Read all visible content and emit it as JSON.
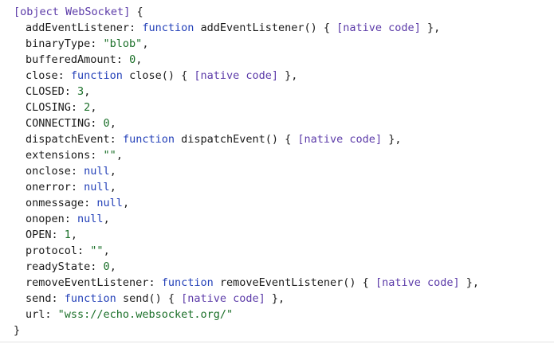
{
  "output": {
    "open": {
      "bracket_open": "[",
      "label": "object WebSocket",
      "bracket_close": "]",
      "brace": " {"
    },
    "props": [
      {
        "key": "addEventListener",
        "kind": "fn",
        "prefix": "function ",
        "fname": "addEventListener",
        "parens": "() { ",
        "native": "[native code]",
        "tail": " },"
      },
      {
        "key": "binaryType",
        "kind": "str",
        "value": "\"blob\"",
        "tail": ","
      },
      {
        "key": "bufferedAmount",
        "kind": "num",
        "value": "0",
        "tail": ","
      },
      {
        "key": "close",
        "kind": "fn",
        "prefix": "function ",
        "fname": "close",
        "parens": "() { ",
        "native": "[native code]",
        "tail": " },"
      },
      {
        "key": "CLOSED",
        "kind": "num",
        "value": "3",
        "tail": ","
      },
      {
        "key": "CLOSING",
        "kind": "num",
        "value": "2",
        "tail": ","
      },
      {
        "key": "CONNECTING",
        "kind": "num",
        "value": "0",
        "tail": ","
      },
      {
        "key": "dispatchEvent",
        "kind": "fn",
        "prefix": "function ",
        "fname": "dispatchEvent",
        "parens": "() { ",
        "native": "[native code]",
        "tail": " },"
      },
      {
        "key": "extensions",
        "kind": "str",
        "value": "\"\"",
        "tail": ","
      },
      {
        "key": "onclose",
        "kind": "kw",
        "value": "null",
        "tail": ","
      },
      {
        "key": "onerror",
        "kind": "kw",
        "value": "null",
        "tail": ","
      },
      {
        "key": "onmessage",
        "kind": "kw",
        "value": "null",
        "tail": ","
      },
      {
        "key": "onopen",
        "kind": "kw",
        "value": "null",
        "tail": ","
      },
      {
        "key": "OPEN",
        "kind": "num",
        "value": "1",
        "tail": ","
      },
      {
        "key": "protocol",
        "kind": "str",
        "value": "\"\"",
        "tail": ","
      },
      {
        "key": "readyState",
        "kind": "num",
        "value": "0",
        "tail": ","
      },
      {
        "key": "removeEventListener",
        "kind": "fn",
        "prefix": "function ",
        "fname": "removeEventListener",
        "parens": "() { ",
        "native": "[native code]",
        "tail": " },"
      },
      {
        "key": "send",
        "kind": "fn",
        "prefix": "function ",
        "fname": "send",
        "parens": "() { ",
        "native": "[native code]",
        "tail": " },"
      },
      {
        "key": "url",
        "kind": "str",
        "value": "\"wss://echo.websocket.org/\"",
        "tail": ""
      }
    ],
    "close": "}"
  },
  "colors": {
    "punctuation_purple": "#5b3aa8",
    "keyword_blue": "#2340b8",
    "literal_green": "#1a6f28",
    "text": "#1a1a1a"
  }
}
